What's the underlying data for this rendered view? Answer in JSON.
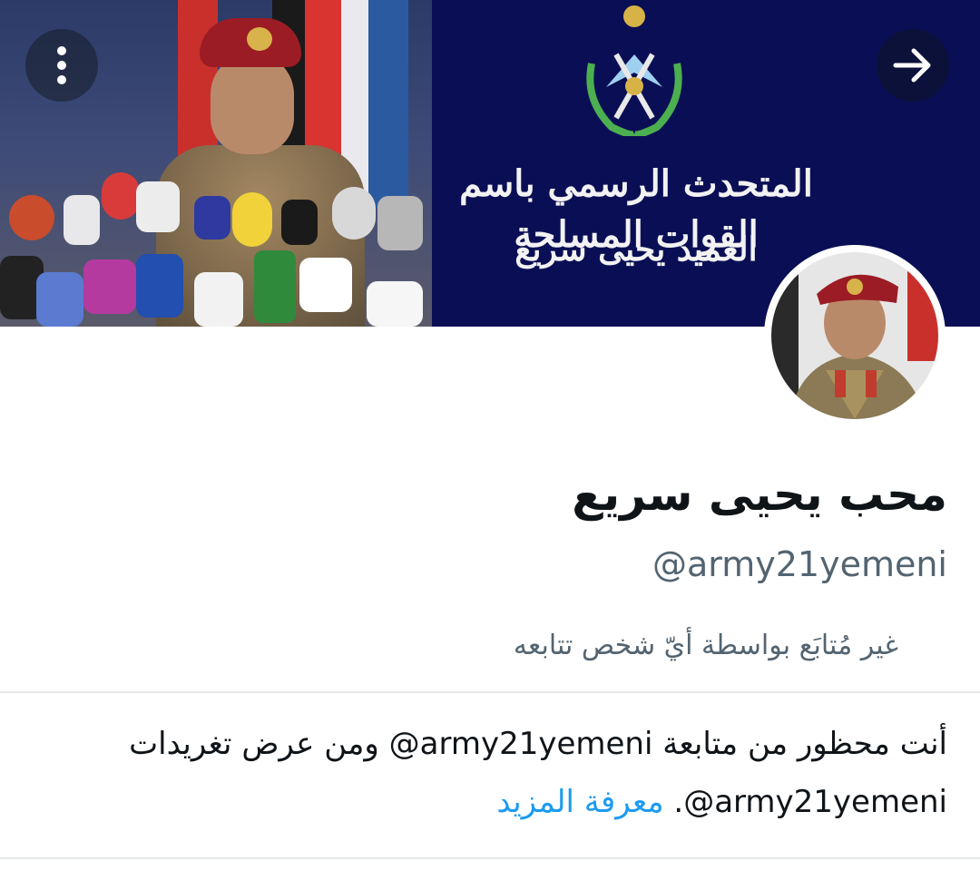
{
  "header": {
    "banner_title": "المتحدث الرسمي باسم القوات المسلحة",
    "banner_subtitle": "العميد يحيى سريع",
    "more_icon": "more-vertical-icon",
    "next_icon": "arrow-right-icon"
  },
  "profile": {
    "display_name": "محب يحيى سريع",
    "handle": "@army21yemeni",
    "follow_status": "غير مُتابَع بواسطة أيّ شخص تتابعه"
  },
  "blocked_notice": {
    "line_1_prefix": "أنت محظور من متابعة",
    "handle": "@army21yemeni",
    "line_1_suffix": "ومن عرض تغريدات",
    "trailing_period": ".",
    "learn_more_label": "معرفة المزيد"
  },
  "colors": {
    "link": "#1d9bf0",
    "secondary_text": "#536471",
    "primary_text": "#0f1419",
    "banner_navy": "#0a0f55"
  }
}
